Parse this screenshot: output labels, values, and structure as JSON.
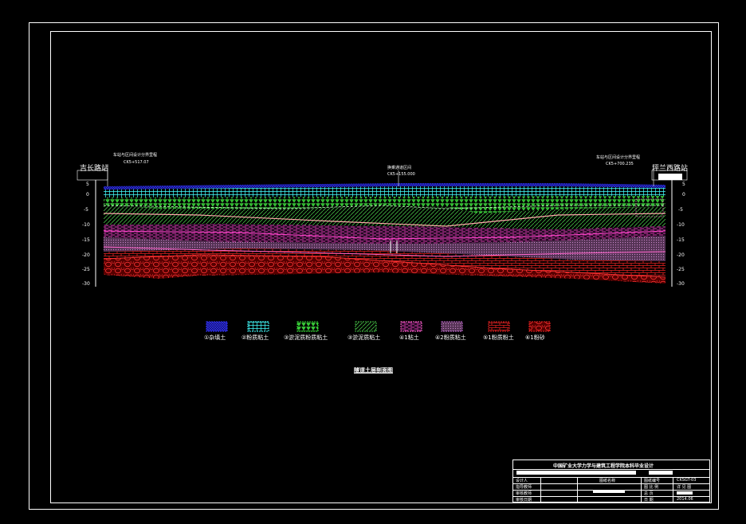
{
  "drawing": {
    "station_left": "吉长路站",
    "station_right": "坪兰西路站",
    "note_left_line1": "车站与区间设计分界里程",
    "note_left_line2": "CK5+517.07",
    "note_center_line1": "换乘通道区间",
    "note_center_line2": "CK5+155.000",
    "note_right_line1": "车站与区间设计分界里程",
    "note_right_line2": "CK5+700.235",
    "depth_ticks": [
      "5",
      "0",
      "-5",
      "-10",
      "-15",
      "-20",
      "-25",
      "-30"
    ],
    "caption": "隧道土层剖面图"
  },
  "legend": [
    {
      "label": "①杂填土",
      "color": "#2222cc",
      "pattern": "dense-blue"
    },
    {
      "label": "②粉质粘土",
      "color": "#33ffff",
      "pattern": "grid-cyan"
    },
    {
      "label": "③淤泥质粉质粘土",
      "color": "#33dd33",
      "pattern": "triangles-green"
    },
    {
      "label": "③淤泥质粘土",
      "color": "#44bb44",
      "pattern": "hatch-green"
    },
    {
      "label": "④1粘土",
      "color": "#ff66cc",
      "pattern": "dash-pink"
    },
    {
      "label": "④2粉质粘土",
      "color": "#bb66cc",
      "pattern": "dots-purple"
    },
    {
      "label": "⑤1粉质粉土",
      "color": "#ee2222",
      "pattern": "brick-red"
    },
    {
      "label": "⑥1粉砂",
      "color": "#ee2222",
      "pattern": "circles-red"
    }
  ],
  "title_block": {
    "title": "中国矿业大学力学与建筑工程学院本科毕业设计",
    "r1_c1": "设计人",
    "r2_c1": "指导教师",
    "r3_c1": "审核教师",
    "r4_c1": "审核日期",
    "mid_label": "图纸名称",
    "right_r1_label": "图纸编号",
    "right_r1_value": "CKSGT-03",
    "right_r2_label": "图 比 例",
    "right_r2_value": "详 见 图",
    "right_r3_label": "总   页",
    "right_r4_label": "日   期",
    "right_r4_value": "2014.06"
  }
}
